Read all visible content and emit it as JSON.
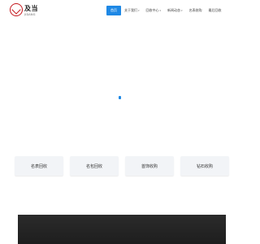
{
  "brand": {
    "name_cn": "及当",
    "name_en": "JIDANG"
  },
  "nav": {
    "items": [
      {
        "label": "首页",
        "active": true,
        "has_dropdown": false
      },
      {
        "label": "关于我们",
        "active": false,
        "has_dropdown": true
      },
      {
        "label": "回收中心",
        "active": false,
        "has_dropdown": true
      },
      {
        "label": "新闻动态",
        "active": false,
        "has_dropdown": true
      },
      {
        "label": "名表收购",
        "active": false,
        "has_dropdown": false
      },
      {
        "label": "最后回收",
        "active": false,
        "has_dropdown": false
      }
    ],
    "caret_glyph": "▾"
  },
  "services": {
    "cards": [
      {
        "label": "名表回收"
      },
      {
        "label": "名包回收"
      },
      {
        "label": "首饰收购"
      },
      {
        "label": "钻石收购"
      }
    ]
  },
  "colors": {
    "accent": "#1e88e5",
    "logo_red": "#c4161c"
  }
}
